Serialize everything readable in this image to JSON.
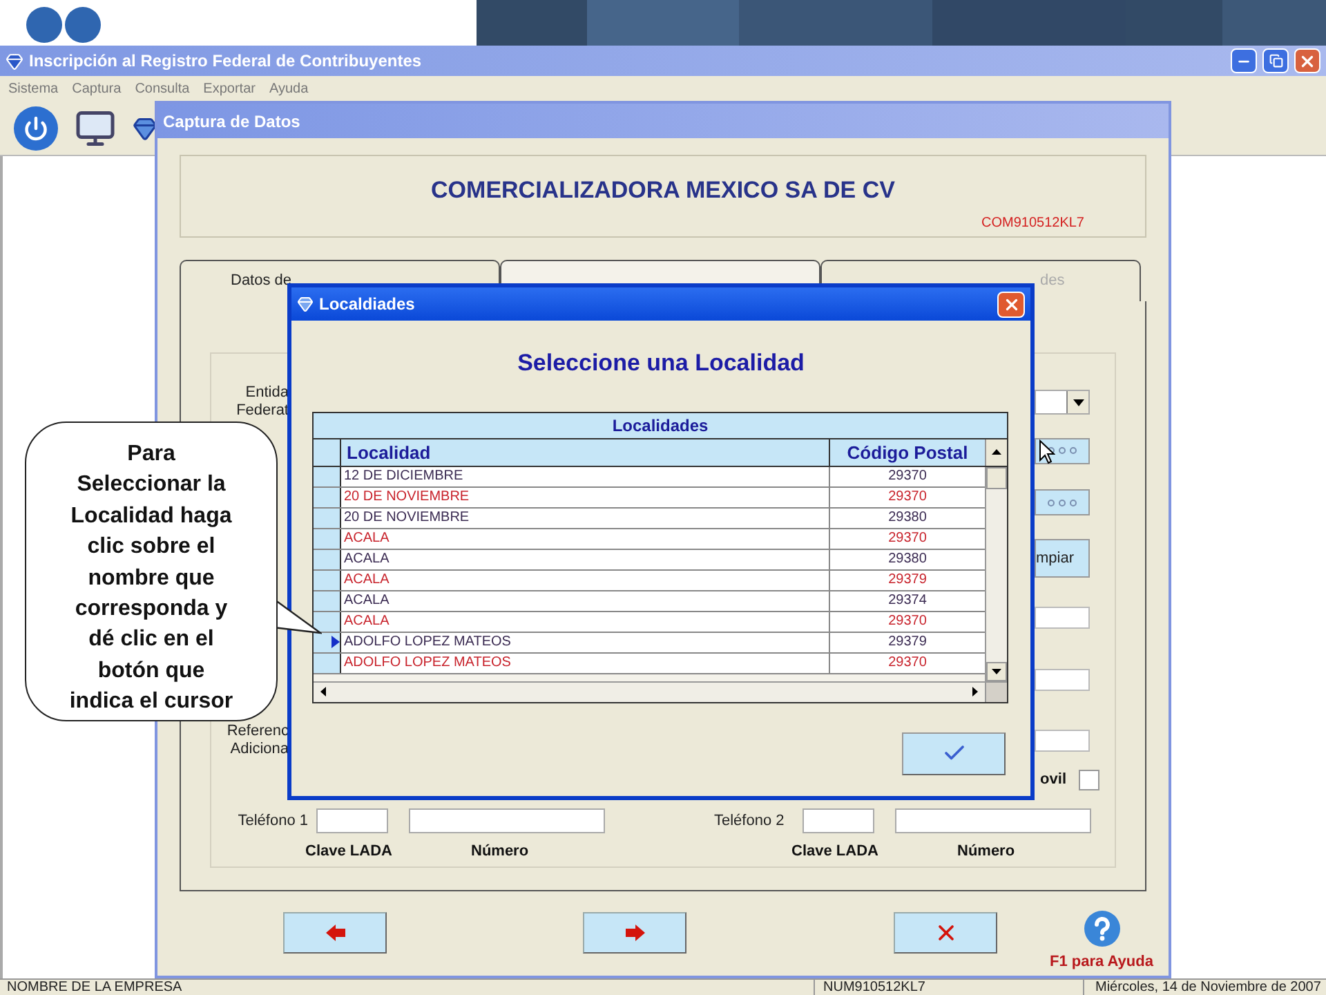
{
  "window": {
    "title": "Inscripción al Registro Federal de Contribuyentes"
  },
  "menu": [
    "Sistema",
    "Captura",
    "Consulta",
    "Exportar",
    "Ayuda"
  ],
  "capture": {
    "title": "Captura de Datos",
    "company": "COMERCIALIZADORA MEXICO SA DE CV",
    "rfc": "COM910512KL7",
    "tabs": [
      {
        "label": "Datos de",
        "selected": false,
        "disabled": false
      },
      {
        "selected": true,
        "disabled": false
      },
      {
        "label": "des",
        "selected": false,
        "disabled": true
      }
    ],
    "rows": [
      {
        "kind": "dropdown",
        "label": [
          "Entida",
          "Federat"
        ]
      },
      {
        "kind": "ellipsis"
      },
      {
        "kind": "ellipsis"
      },
      {
        "kind": "button",
        "text": "mpiar"
      },
      {
        "kind": "field"
      },
      {
        "kind": "field"
      },
      {
        "kind": "field",
        "label": [
          "Referenc",
          "Adiciona"
        ]
      },
      {
        "kind": "checkbox",
        "text": "ovil",
        "checked": false
      }
    ],
    "phones": [
      {
        "label": "Teléfono 1",
        "lada": "Clave LADA",
        "number": "Número"
      },
      {
        "label": "Teléfono 2",
        "lada": "Clave LADA",
        "number": "Número"
      }
    ],
    "nav": [
      {
        "kind": "back"
      },
      {
        "kind": "next"
      },
      {
        "kind": "cancel"
      }
    ],
    "help": "F1 para Ayuda"
  },
  "dialog": {
    "title": "Localdiades",
    "heading": "Seleccione una Localidad",
    "table": {
      "caption": "Localidades",
      "columns": [
        "Localidad",
        "Código Postal"
      ],
      "rows": [
        {
          "localidad": "12 DE DICIEMBRE",
          "cp": "29370",
          "color": "#3b2b52",
          "selected": false
        },
        {
          "localidad": "20 DE NOVIEMBRE",
          "cp": "29370",
          "color": "#c8232c",
          "selected": false
        },
        {
          "localidad": "20 DE NOVIEMBRE",
          "cp": "29380",
          "color": "#3b2b52",
          "selected": false
        },
        {
          "localidad": "ACALA",
          "cp": "29370",
          "color": "#c8232c",
          "selected": false
        },
        {
          "localidad": "ACALA",
          "cp": "29380",
          "color": "#3b2b52",
          "selected": false
        },
        {
          "localidad": "ACALA",
          "cp": "29379",
          "color": "#c8232c",
          "selected": false
        },
        {
          "localidad": "ACALA",
          "cp": "29374",
          "color": "#3b2b52",
          "selected": false
        },
        {
          "localidad": "ACALA",
          "cp": "29370",
          "color": "#c8232c",
          "selected": false
        },
        {
          "localidad": "ADOLFO LOPEZ MATEOS",
          "cp": "29379",
          "color": "#3b2b52",
          "selected": true
        },
        {
          "localidad": "ADOLFO LOPEZ MATEOS",
          "cp": "29370",
          "color": "#c8232c",
          "selected": false
        }
      ]
    }
  },
  "callout": [
    "Para",
    "Seleccionar la",
    "Localidad haga",
    "clic sobre el",
    "nombre que",
    "corresponda y",
    "dé clic en el",
    "botón que",
    "indica el cursor"
  ],
  "status_bar": [
    "NOMBRE DE LA EMPRESA",
    "NUM910512KL7",
    "Miércoles, 14 de Noviembre de 2007"
  ]
}
